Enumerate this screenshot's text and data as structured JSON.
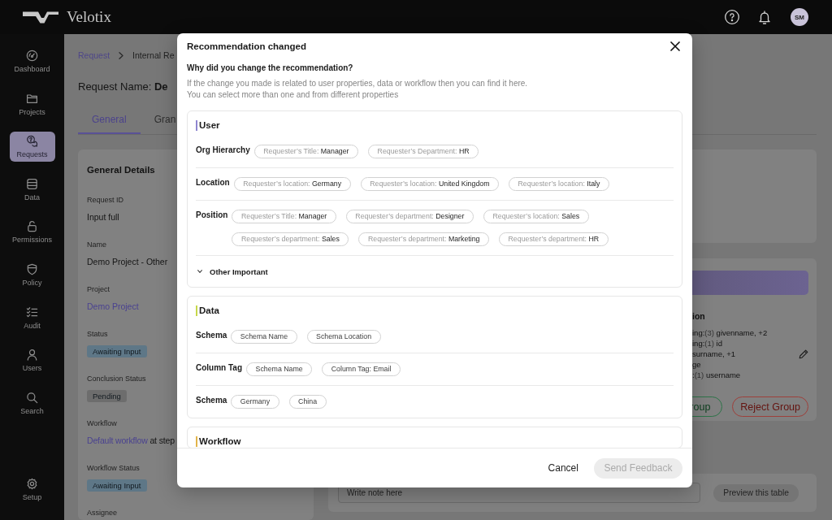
{
  "header": {
    "logo": "Velotix",
    "avatar": "SM"
  },
  "sidebar": {
    "items": [
      {
        "label": "Dashboard",
        "selected": false
      },
      {
        "label": "Projects",
        "selected": false
      },
      {
        "label": "Requests",
        "selected": true
      },
      {
        "label": "Data",
        "selected": false
      },
      {
        "label": "Permissions",
        "selected": false
      },
      {
        "label": "Policy",
        "selected": false
      },
      {
        "label": "Audit",
        "selected": false
      },
      {
        "label": "Users",
        "selected": false
      },
      {
        "label": "Search",
        "selected": false
      }
    ],
    "bottom_items": [
      {
        "label": "Setup",
        "selected": false
      }
    ]
  },
  "breadcrumb": [
    {
      "label": "Request",
      "kind": "link"
    },
    {
      "label": "Internal Re",
      "kind": "current"
    }
  ],
  "page_title": "Request Name: **De**",
  "tabs": [
    {
      "label": "General",
      "selected": true
    },
    {
      "label": "Gran",
      "selected": false
    }
  ],
  "details": {
    "title": "General Details",
    "fields": [
      {
        "label": "Request ID",
        "kind": "text",
        "value": "Input full"
      },
      {
        "label": "Name",
        "kind": "text",
        "value": "Demo Project - Other"
      },
      {
        "label": "Project",
        "kind": "link",
        "value": "Demo Project"
      },
      {
        "label": "Status",
        "kind": "badge",
        "value": "Awaiting Input",
        "color": "#5e7787"
      },
      {
        "label": "Conclusion Status",
        "kind": "badge",
        "value": "Pending",
        "color": "#6d6d6d"
      },
      {
        "label": "Workflow",
        "kind": "link_text",
        "link": "Default workflow",
        "text": "at step"
      },
      {
        "label": "Workflow Status",
        "kind": "badge",
        "value": "Awaiting Input",
        "color": "#5e7787"
      },
      {
        "label": "Assignee",
        "kind": "text"
      }
    ]
  },
  "side_card": {
    "heading": "ion",
    "lines": [
      {
        "lead": "ing:",
        "count": "(3)",
        "rest": "givenname, +2"
      },
      {
        "lead": "ing:",
        "count": "(1)",
        "rest": "id"
      },
      {
        "rest": "surname, +1"
      },
      {
        "rest": "ge"
      },
      {
        "lead": ":",
        "count": "(1)",
        "rest": "username"
      }
    ],
    "buttons": [
      {
        "label": "roup",
        "kind": "approve"
      },
      {
        "label": "Reject Group",
        "kind": "reject"
      }
    ]
  },
  "note": {
    "placeholder": "Write note here",
    "button": {
      "label": "Preview this table",
      "disabled": true
    }
  },
  "modal": {
    "title": "Recommendation changed",
    "question": "Why did you change the recommendation?",
    "description": [
      "If the change you made is related to user properties, data or workflow then you can find it here.",
      "You can select more than one and from different properties"
    ],
    "sections": [
      {
        "title": "User",
        "color": "#8f86d0",
        "rows": [
          {
            "label": "Org Hierarchy",
            "chips": [
              {
                "prefix": "Requester’s Title:",
                "value": "Manager",
                "selected": false
              },
              {
                "prefix": "Requester’s Department:",
                "value": "HR",
                "selected": false
              }
            ]
          },
          {
            "label": "Location",
            "chips": [
              {
                "prefix": "Requester’s location:",
                "value": "Germany",
                "selected": false
              },
              {
                "prefix": "Requester’s location:",
                "value": "United Kingdom",
                "selected": false
              },
              {
                "prefix": "Requester’s location:",
                "value": "Italy",
                "selected": false
              }
            ]
          },
          {
            "label": "Position",
            "chips": [
              {
                "prefix": "Requester’s Title:",
                "value": "Manager",
                "selected": false
              },
              {
                "prefix": "Requester’s department:",
                "value": "Designer",
                "selected": false
              },
              {
                "prefix": "Requester’s location:",
                "value": "Sales",
                "selected": false
              },
              {
                "prefix": "Requester’s department:",
                "value": "Sales",
                "selected": false
              },
              {
                "prefix": "Requester’s department:",
                "value": "Marketing",
                "selected": false
              },
              {
                "prefix": "Requester’s department:",
                "value": "HR",
                "selected": false
              }
            ]
          }
        ],
        "toggle": {
          "label": "Other Important",
          "expanded": false
        }
      },
      {
        "title": "Data",
        "color": "#c6d84a",
        "rows": [
          {
            "label": "Schema",
            "chips": [
              {
                "value": "Schema Name",
                "selected": false
              },
              {
                "value": "Schema Location",
                "selected": false
              }
            ]
          },
          {
            "label": "Column Tag",
            "chips": [
              {
                "value": "Schema Name",
                "selected": false
              },
              {
                "value": "Column Tag: Email",
                "selected": false
              }
            ]
          },
          {
            "label": "Schema",
            "chips": [
              {
                "value": "Germany",
                "selected": false
              },
              {
                "value": "China",
                "selected": false
              }
            ]
          }
        ]
      },
      {
        "title": "Workflow",
        "color": "#e2b44a"
      }
    ],
    "cancel": "Cancel",
    "submit": {
      "label": "Send Feedback",
      "disabled": true
    }
  }
}
